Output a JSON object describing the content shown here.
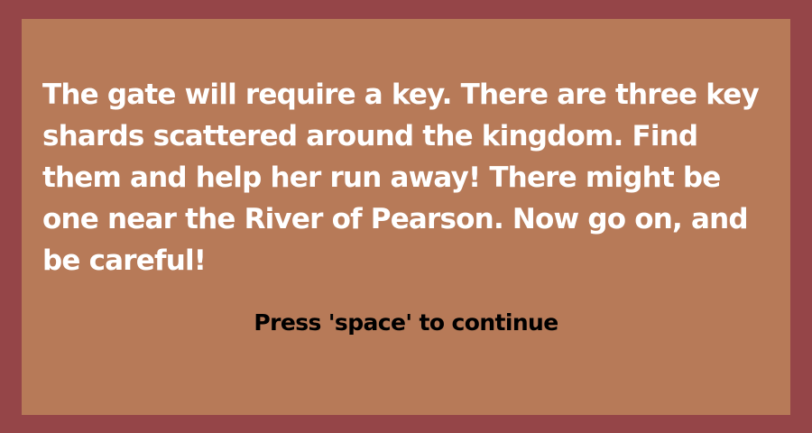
{
  "dialog": {
    "message": "The gate will require a key. There are three key shards scattered around the kingdom. Find them and help her run away! There might be one near the River of Pearson. Now go on, and be careful!",
    "prompt": "Press 'space' to continue"
  },
  "colors": {
    "frame": "#954548",
    "panel": "#b77a58",
    "message_text": "#ffffff",
    "prompt_text": "#000000"
  }
}
